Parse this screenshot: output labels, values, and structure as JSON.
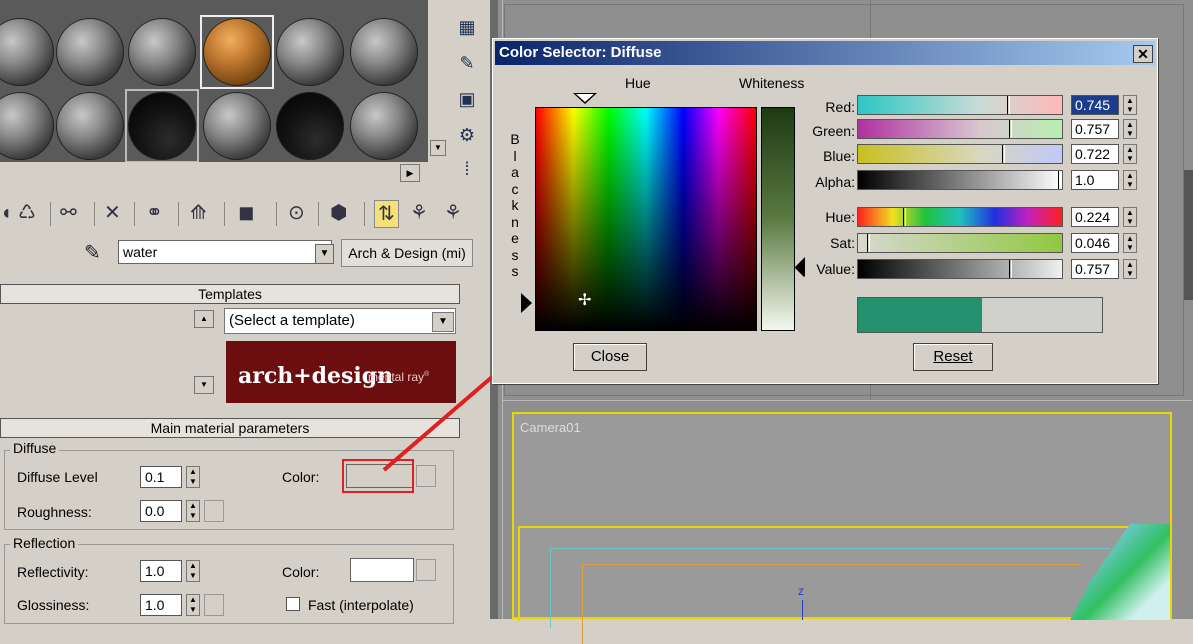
{
  "material_editor": {
    "material_name": "water",
    "material_type": "Arch & Design (mi)",
    "templates_header": "Templates",
    "template_select": "(Select a template)",
    "logo_text": "arch+design",
    "logo_sub": "mental ray",
    "logo_sub_mark": "®",
    "main_params_header": "Main material parameters",
    "diffuse": {
      "group_label": "Diffuse",
      "level_label": "Diffuse Level",
      "level_value": "0.1",
      "roughness_label": "Roughness:",
      "roughness_value": "0.0",
      "color_label": "Color:",
      "color_swatch": "#d4d0c8"
    },
    "reflection": {
      "group_label": "Reflection",
      "reflectivity_label": "Reflectivity:",
      "reflectivity_value": "1.0",
      "glossiness_label": "Glossiness:",
      "glossiness_value": "1.0",
      "color_label": "Color:",
      "color_swatch": "#ffffff",
      "fast_label": "Fast (interpolate)"
    }
  },
  "color_selector": {
    "title": "Color Selector: Diffuse",
    "hue_label": "Hue",
    "whiteness_label": "Whiteness",
    "blackness_label": "Blackness",
    "blackness_letters": [
      "B",
      "l",
      "a",
      "c",
      "k",
      "n",
      "e",
      "s",
      "s"
    ],
    "channels": [
      {
        "label": "Red:",
        "value": "0.745",
        "level": 0.745
      },
      {
        "label": "Green:",
        "value": "0.757",
        "level": 0.757
      },
      {
        "label": "Blue:",
        "value": "0.722",
        "level": 0.722
      },
      {
        "label": "Alpha:",
        "value": "1.0",
        "level": 1.0
      }
    ],
    "hsv": [
      {
        "label": "Hue:",
        "value": "0.224",
        "level": 0.224
      },
      {
        "label": "Sat:",
        "value": "0.046",
        "level": 0.046
      },
      {
        "label": "Value:",
        "value": "0.757",
        "level": 0.757
      }
    ],
    "preview_new_color": "#23906e",
    "preview_old_color": "#d0d0cc",
    "close_label": "Close",
    "reset_label": "Reset"
  },
  "viewport": {
    "camera_label": "Camera01",
    "axis_label": "z"
  },
  "annotation": {
    "arrow_color": "#e02020"
  }
}
